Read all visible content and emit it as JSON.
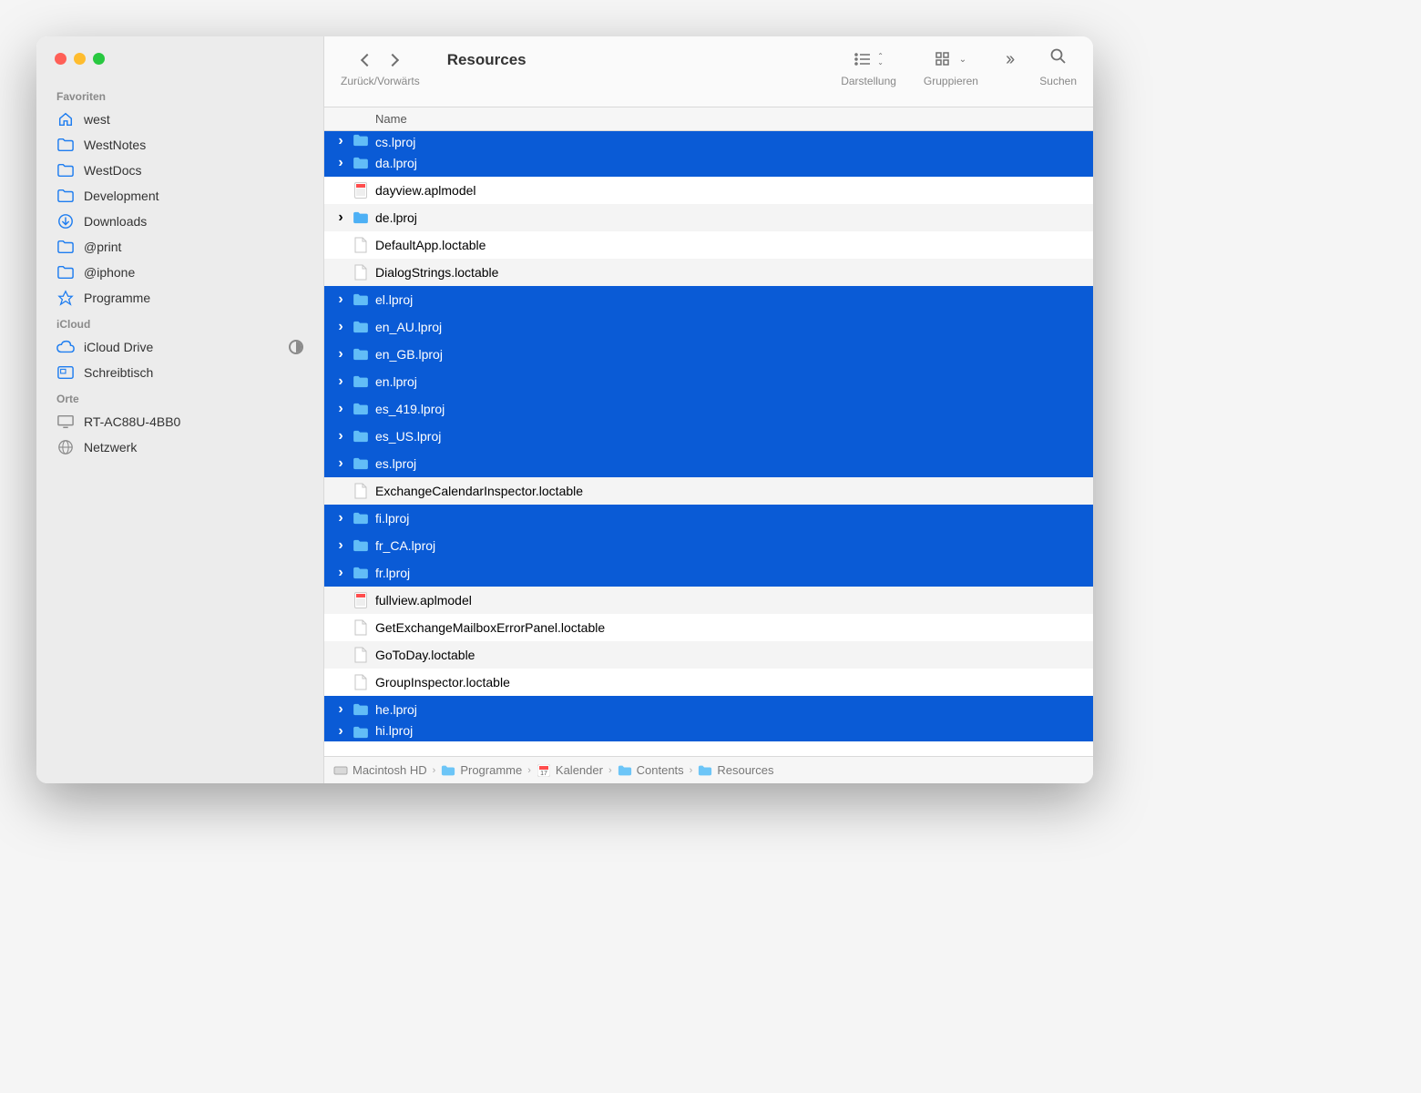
{
  "sidebar": {
    "sections": [
      {
        "title": "Favoriten",
        "items": [
          {
            "icon": "home",
            "label": "west"
          },
          {
            "icon": "folder",
            "label": "WestNotes"
          },
          {
            "icon": "folder",
            "label": "WestDocs"
          },
          {
            "icon": "folder",
            "label": "Development"
          },
          {
            "icon": "download",
            "label": "Downloads"
          },
          {
            "icon": "folder",
            "label": "@print"
          },
          {
            "icon": "folder",
            "label": "@iphone"
          },
          {
            "icon": "appstore",
            "label": "Programme"
          }
        ]
      },
      {
        "title": "iCloud",
        "items": [
          {
            "icon": "cloud",
            "label": "iCloud Drive",
            "progress": true
          },
          {
            "icon": "desktop",
            "label": "Schreibtisch"
          }
        ]
      },
      {
        "title": "Orte",
        "items": [
          {
            "icon": "display",
            "label": "RT-AC88U-4BB0",
            "gray": true
          },
          {
            "icon": "globe",
            "label": "Netzwerk",
            "gray": true
          }
        ]
      }
    ]
  },
  "toolbar": {
    "nav_label": "Zurück/Vorwärts",
    "title": "Resources",
    "view_label": "Darstellung",
    "group_label": "Gruppieren",
    "search_label": "Suchen"
  },
  "columns": {
    "name": "Name"
  },
  "files": [
    {
      "name": "cs.lproj",
      "type": "folder",
      "selected": true,
      "cut": true
    },
    {
      "name": "da.lproj",
      "type": "folder",
      "selected": true
    },
    {
      "name": "dayview.aplmodel",
      "type": "cal",
      "selected": false
    },
    {
      "name": "de.lproj",
      "type": "folder",
      "selected": false
    },
    {
      "name": "DefaultApp.loctable",
      "type": "doc",
      "selected": false
    },
    {
      "name": "DialogStrings.loctable",
      "type": "doc",
      "selected": false
    },
    {
      "name": "el.lproj",
      "type": "folder",
      "selected": true
    },
    {
      "name": "en_AU.lproj",
      "type": "folder",
      "selected": true
    },
    {
      "name": "en_GB.lproj",
      "type": "folder",
      "selected": true
    },
    {
      "name": "en.lproj",
      "type": "folder",
      "selected": true
    },
    {
      "name": "es_419.lproj",
      "type": "folder",
      "selected": true
    },
    {
      "name": "es_US.lproj",
      "type": "folder",
      "selected": true
    },
    {
      "name": "es.lproj",
      "type": "folder",
      "selected": true
    },
    {
      "name": "ExchangeCalendarInspector.loctable",
      "type": "doc",
      "selected": false
    },
    {
      "name": "fi.lproj",
      "type": "folder",
      "selected": true
    },
    {
      "name": "fr_CA.lproj",
      "type": "folder",
      "selected": true
    },
    {
      "name": "fr.lproj",
      "type": "folder",
      "selected": true
    },
    {
      "name": "fullview.aplmodel",
      "type": "cal",
      "selected": false
    },
    {
      "name": "GetExchangeMailboxErrorPanel.loctable",
      "type": "doc",
      "selected": false
    },
    {
      "name": "GoToDay.loctable",
      "type": "doc",
      "selected": false
    },
    {
      "name": "GroupInspector.loctable",
      "type": "doc",
      "selected": false
    },
    {
      "name": "he.lproj",
      "type": "folder",
      "selected": true
    },
    {
      "name": "hi.lproj",
      "type": "folder",
      "selected": true,
      "cut": true
    }
  ],
  "path": [
    {
      "icon": "drive",
      "label": "Macintosh HD"
    },
    {
      "icon": "appfolder",
      "label": "Programme"
    },
    {
      "icon": "calapp",
      "label": "Kalender"
    },
    {
      "icon": "folder",
      "label": "Contents"
    },
    {
      "icon": "folder",
      "label": "Resources"
    }
  ]
}
